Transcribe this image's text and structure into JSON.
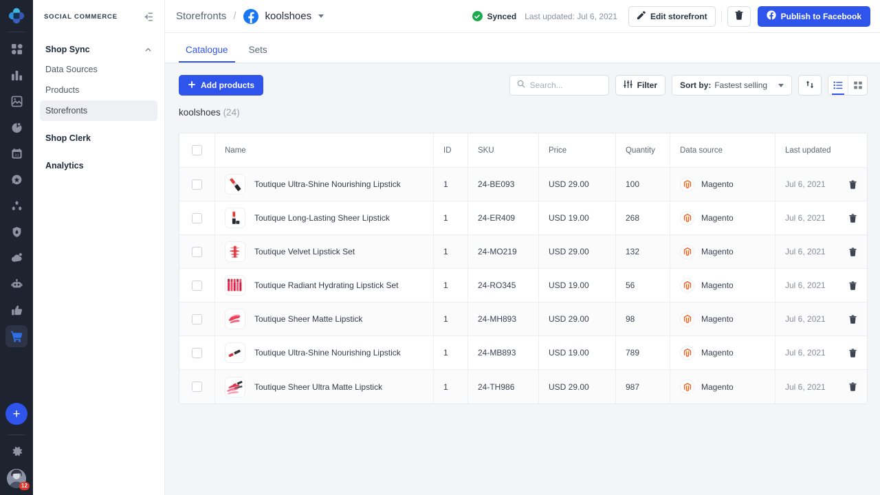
{
  "colors": {
    "accent": "#2f54eb",
    "rail_bg": "#1e2330",
    "facebook": "#1877f2",
    "magento": "#f26322",
    "success": "#1bab4e",
    "badge_red": "#e5342b"
  },
  "rail": {
    "logo_name": "clover-logo",
    "icons": [
      {
        "name": "dashboard-icon",
        "active": false
      },
      {
        "name": "bar-chart-icon",
        "active": false
      },
      {
        "name": "image-icon",
        "active": false
      },
      {
        "name": "pie-chart-icon",
        "active": false
      },
      {
        "name": "calendar-icon",
        "active": false
      },
      {
        "name": "star-message-icon",
        "active": false
      },
      {
        "name": "hierarchy-icon",
        "active": false
      },
      {
        "name": "shield-icon",
        "active": false
      },
      {
        "name": "cloud-icon",
        "active": false
      },
      {
        "name": "robot-icon",
        "active": false
      },
      {
        "name": "thumbs-up-icon",
        "active": false
      },
      {
        "name": "shopping-cart-icon",
        "active": true
      }
    ],
    "add_label": "+",
    "settings_name": "gear-icon",
    "avatar_badge": "12"
  },
  "sidebar": {
    "title": "SOCIAL COMMERCE",
    "collapse_icon": "collapse-sidebar-icon",
    "groups": [
      {
        "label": "Shop Sync",
        "expanded": true,
        "items": [
          {
            "label": "Data Sources",
            "active": false
          },
          {
            "label": "Products",
            "active": false
          },
          {
            "label": "Storefronts",
            "active": true
          }
        ]
      }
    ],
    "sections": [
      {
        "label": "Shop Clerk"
      },
      {
        "label": "Analytics"
      }
    ]
  },
  "topbar": {
    "breadcrumb_root": "Storefronts",
    "breadcrumb_separator": "/",
    "channel_icon": "facebook-icon",
    "breadcrumb_current": "koolshoes",
    "sync_status": "Synced",
    "last_updated": "Last updated: Jul 6, 2021",
    "edit_label": "Edit storefront",
    "delete_icon": "trash-icon",
    "publish_label": "Publish to Facebook"
  },
  "tabs": [
    {
      "label": "Catalogue",
      "active": true
    },
    {
      "label": "Sets",
      "active": false
    }
  ],
  "toolbar": {
    "add_products_label": "Add products",
    "search_placeholder": "Search...",
    "search_value": "",
    "filter_label": "Filter",
    "sort_label": "Sort by:",
    "sort_value": "Fastest selling",
    "sort_direction_icon": "sort-direction-icon",
    "view_list_icon": "list-view-icon",
    "view_grid_icon": "grid-view-icon",
    "view_active": "list"
  },
  "catalogue": {
    "name": "koolshoes",
    "count": "(24)"
  },
  "table": {
    "columns": [
      "Name",
      "ID",
      "SKU",
      "Price",
      "Quantity",
      "Data source",
      "Last updated"
    ],
    "rows": [
      {
        "thumb": "lipstick-open-diagonal",
        "name": "Toutique Ultra-Shine Nourishing Lipstick",
        "id": "1",
        "sku": "24-BE093",
        "price": "USD 29.00",
        "quantity": "100",
        "source": "Magento",
        "updated": "Jul 6, 2021"
      },
      {
        "thumb": "lipstick-upright",
        "name": "Toutique Long-Lasting Sheer Lipstick",
        "id": "1",
        "sku": "24-ER409",
        "price": "USD 19.00",
        "quantity": "268",
        "source": "Magento",
        "updated": "Jul 6, 2021"
      },
      {
        "thumb": "lipstick-swatches",
        "name": "Toutique Velvet Lipstick Set",
        "id": "1",
        "sku": "24-MO219",
        "price": "USD 29.00",
        "quantity": "132",
        "source": "Magento",
        "updated": "Jul 6, 2021"
      },
      {
        "thumb": "lipstick-row-set",
        "name": "Toutique Radiant Hydrating Lipstick Set",
        "id": "1",
        "sku": "24-RO345",
        "price": "USD 19.00",
        "quantity": "56",
        "source": "Magento",
        "updated": "Jul 6, 2021"
      },
      {
        "thumb": "lipstick-smear",
        "name": "Toutique Sheer Matte Lipstick",
        "id": "1",
        "sku": "24-MH893",
        "price": "USD 29.00",
        "quantity": "98",
        "source": "Magento",
        "updated": "Jul 6, 2021"
      },
      {
        "thumb": "lipstick-lying-diagonal",
        "name": "Toutique Ultra-Shine Nourishing Lipstick",
        "id": "1",
        "sku": "24-MB893",
        "price": "USD 19.00",
        "quantity": "789",
        "source": "Magento",
        "updated": "Jul 6, 2021"
      },
      {
        "thumb": "lipstick-multi-smear",
        "name": "Toutique Sheer Ultra Matte Lipstick",
        "id": "1",
        "sku": "24-TH986",
        "price": "USD 29.00",
        "quantity": "987",
        "source": "Magento",
        "updated": "Jul 6, 2021"
      }
    ]
  }
}
